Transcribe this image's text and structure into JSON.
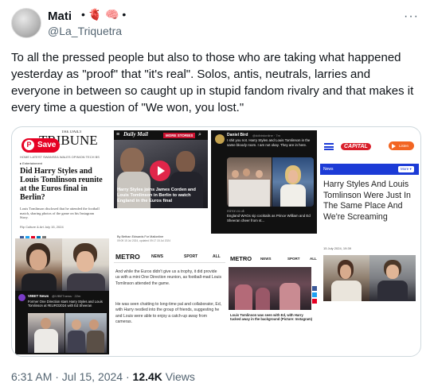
{
  "user": {
    "name": "Mati",
    "name_icons": "• 🫀 🧠 •",
    "handle": "@La_Triquetra",
    "more": "···"
  },
  "tweet": {
    "text": "To all the pressed people but also to those who are taking what happened yesterday as \"proof\" that \"it's real\". Solos, antis, neutrals, larries and everyone in between so caught up in stupid fandom rivalry and that makes it every time a question of \"We won, you lost.\""
  },
  "panel1": {
    "pinterest_save": "Save",
    "masthead": "TRIBUNE",
    "masthead_prefix": "THE DAILY",
    "nav": "HOME   LATEST   SWANSEA   WALES   OPINION   TECH   BS",
    "section": "▸ Entertainment",
    "headline": "Did Harry Styles and Louis Tomlinson reunite at the Euros final in Berlin?",
    "body": "Louis Tomlinson disclosed that he attended the football match, sharing photos of the game on his Instagram Story.",
    "byline": "Rip Culture & Art    July 15, 2024",
    "overlay_source": "VIBET News",
    "overlay_handle": "@VIBETnews · 22m",
    "overlay_text": "Former One Direction stars Harry Styles and Louis Tomlinson at #EURO2024 with Ed Sheeran"
  },
  "panel2": {
    "logo": "Daily Mail",
    "more_stories": "MORE STORIES",
    "caption": "Harry Styles joins James Corden and Louis Tomlinson in Berlin to watch England in the Euros final",
    "byline": "By Bethan Edwards For Mailonline",
    "dates": "09:09 15 Jul 2024, updated 09:17 15 Jul 2024"
  },
  "panel3": {
    "name": "Daniel Bird",
    "handle": "@ddbirdonline · 7m",
    "tweet": "I shit you not. Harry Styles and Louis Tomlinson in the same bloody room. I am not okay. They are in here.",
    "source": "mirror.co.uk",
    "link_text": "England WAGs sip cocktails as Prince William and Ed Sheeran cheer from st..."
  },
  "panel4": {
    "logo": "CAPITAL",
    "listen": "Listen",
    "section": "News",
    "more": "More",
    "headline": "Harry Styles And Louis Tomlinson Were Just In The Same Place And We're Screaming",
    "date": "15 July 2024, 19:39"
  },
  "panel5": {
    "logo": "METRO",
    "tabs": [
      "NEWS",
      "SPORT",
      "ALL"
    ],
    "p1": "And while the Euros didn't give us a trophy, it did provide us with a mini One Direction reunion, as football-mad Louis Tomlinson attended the game.",
    "p2": "He was seen chatting to long-time pal and collaborator, Ed, with Harry nestled into the group of friends, suggesting he and Louis were able to enjoy a catch-up away from cameras."
  },
  "panel6": {
    "logo": "METRO",
    "tabs": [
      "NEWS",
      "SPORT",
      "ALL"
    ],
    "caption": "Louis Tomlinson was seen with Ed, with Harry tucked away in the background (Picture: Instagram)"
  },
  "footer": {
    "time": "6:31 AM · Jul 15, 2024 · ",
    "views_count": "12.4K",
    "views_label": " Views"
  },
  "colors": {
    "text": "#0f1419",
    "muted": "#536471",
    "border": "#cfd9de",
    "pinterest": "#e60023",
    "dailymail_red": "#c8102e",
    "capital_blue": "#1c3bd6",
    "capital_listen": "#f26522"
  }
}
